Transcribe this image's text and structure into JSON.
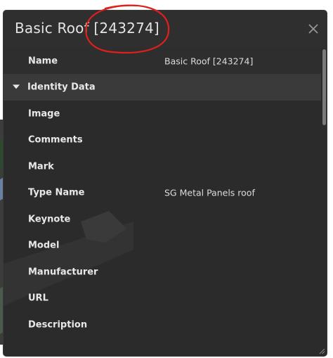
{
  "panel": {
    "title": "Basic Roof [243274]",
    "close_icon": "close-icon",
    "name_row": {
      "label": "Name",
      "value": "Basic Roof [243274]"
    },
    "group": {
      "label": "Identity Data",
      "expanded": true,
      "icon": "caret-down-icon"
    },
    "properties": [
      {
        "label": "Image",
        "value": ""
      },
      {
        "label": "Comments",
        "value": ""
      },
      {
        "label": "Mark",
        "value": ""
      },
      {
        "label": "Type Name",
        "value": "SG Metal Panels roof"
      },
      {
        "label": "Keynote",
        "value": ""
      },
      {
        "label": "Model",
        "value": ""
      },
      {
        "label": "Manufacturer",
        "value": ""
      },
      {
        "label": "URL",
        "value": ""
      },
      {
        "label": "Description",
        "value": ""
      }
    ]
  },
  "colors": {
    "panel_bg": "#2b2b2b",
    "group_row_bg": "#3a3a3a",
    "text": "#e8e8e8",
    "annotation_red": "#e0201c"
  }
}
